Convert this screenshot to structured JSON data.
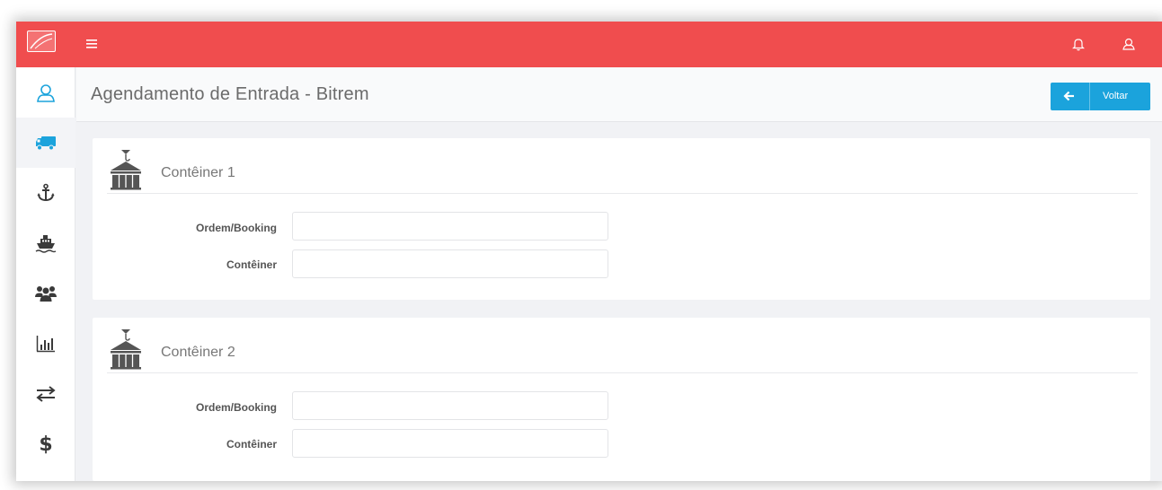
{
  "header": {
    "title": "Agendamento de Entrada - Bitrem",
    "back_button_label": "Voltar"
  },
  "topbar": {
    "icons": [
      "menu-icon",
      "bell-icon",
      "user-icon"
    ],
    "color": "#f04d4e"
  },
  "sidebar": {
    "items": [
      {
        "icon": "user-icon",
        "active": false
      },
      {
        "icon": "truck-icon",
        "active": true
      },
      {
        "icon": "anchor-icon",
        "active": false
      },
      {
        "icon": "ship-icon",
        "active": false
      },
      {
        "icon": "users-icon",
        "active": false
      },
      {
        "icon": "bar-chart-icon",
        "active": false
      },
      {
        "icon": "transfer-icon",
        "active": false
      },
      {
        "icon": "dollar-icon",
        "label": "$",
        "active": false
      }
    ],
    "active_color": "#1ba3dc"
  },
  "containers": [
    {
      "title": "Contêiner 1",
      "icon": "crane-icon",
      "fields": [
        {
          "label": "Ordem/Booking",
          "value": ""
        },
        {
          "label": "Contêiner",
          "value": ""
        }
      ]
    },
    {
      "title": "Contêiner 2",
      "icon": "crane-icon",
      "fields": [
        {
          "label": "Ordem/Booking",
          "value": ""
        },
        {
          "label": "Contêiner",
          "value": ""
        }
      ]
    }
  ],
  "colors": {
    "accent": "#1ba3dc",
    "topbar": "#f04d4e",
    "background": "#f1f2f5"
  }
}
